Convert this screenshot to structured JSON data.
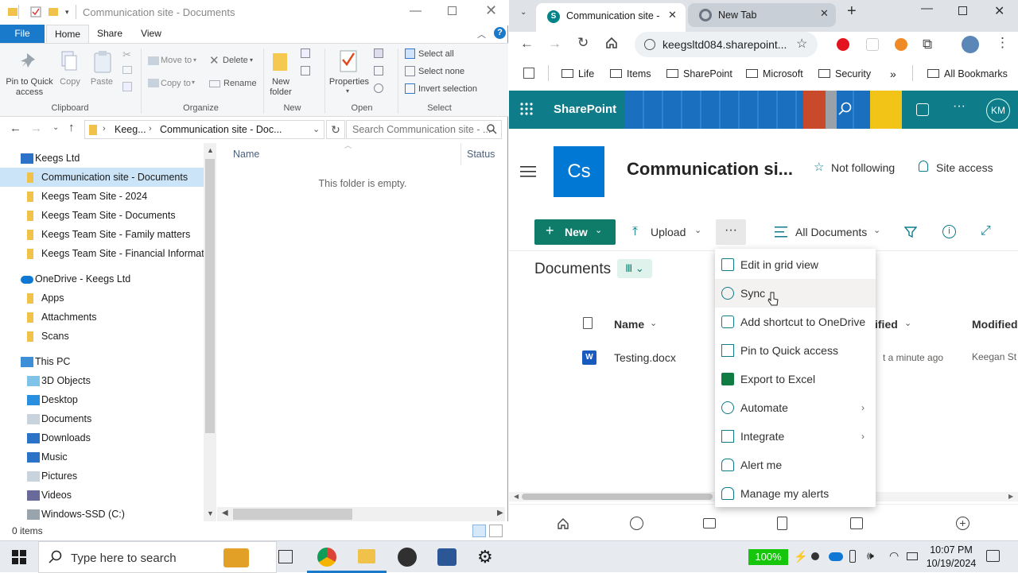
{
  "explorer": {
    "title": "Communication site - Documents",
    "tabs": [
      "File",
      "Home",
      "Share",
      "View"
    ],
    "ribbon": {
      "clipboard": {
        "pin": "Pin to Quick access",
        "copy": "Copy",
        "paste": "Paste",
        "group": "Clipboard"
      },
      "organize": {
        "move_to": "Move to",
        "copy_to": "Copy to",
        "delete": "Delete",
        "rename": "Rename",
        "group": "Organize"
      },
      "new": {
        "new_folder": "New folder",
        "group": "New"
      },
      "open": {
        "properties": "Properties",
        "group": "Open"
      },
      "select": {
        "select_all": "Select all",
        "select_none": "Select none",
        "invert": "Invert selection",
        "group": "Select"
      }
    },
    "address": {
      "crumb1": "Keeg...",
      "crumb2": "Communication site - Doc...",
      "search_placeholder": "Search Communication site - ..."
    },
    "nav": [
      {
        "label": "Keegs Ltd"
      },
      {
        "label": "Communication site - Documents"
      },
      {
        "label": "Keegs Team Site - 2024"
      },
      {
        "label": "Keegs Team Site - Documents"
      },
      {
        "label": "Keegs Team Site - Family matters"
      },
      {
        "label": "Keegs Team Site - Financial Information"
      },
      {
        "label": "OneDrive - Keegs Ltd"
      },
      {
        "label": "Apps"
      },
      {
        "label": "Attachments"
      },
      {
        "label": "Scans"
      },
      {
        "label": "This PC"
      },
      {
        "label": "3D Objects"
      },
      {
        "label": "Desktop"
      },
      {
        "label": "Documents"
      },
      {
        "label": "Downloads"
      },
      {
        "label": "Music"
      },
      {
        "label": "Pictures"
      },
      {
        "label": "Videos"
      },
      {
        "label": "Windows-SSD (C:)"
      }
    ],
    "columns": {
      "name": "Name",
      "status": "Status"
    },
    "empty_text": "This folder is empty.",
    "status_text": "0 items"
  },
  "chrome": {
    "tabs": [
      {
        "label": "Communication site - "
      },
      {
        "label": "New Tab"
      }
    ],
    "url": "keegsltd084.sharepoint...",
    "bookmarks": [
      "Life",
      "Items",
      "SharePoint",
      "Microsoft",
      "Security"
    ],
    "all_bookmarks": "All Bookmarks",
    "sharepoint": {
      "brand": "SharePoint",
      "avatar": "KM",
      "site_logo": "Cs",
      "site_title": "Communication si...",
      "follow": "Not following",
      "site_access": "Site access",
      "cmd": {
        "new": "New",
        "upload": "Upload",
        "view": "All Documents"
      },
      "library_title": "Documents",
      "columns": {
        "name": "Name",
        "modified_partial": "ified",
        "modified_by": "Modified"
      },
      "files": [
        {
          "name": "Testing.docx",
          "modified": "t a minute ago",
          "modified_by": "Keegan St"
        }
      ],
      "menu": [
        {
          "label": "Edit in grid view"
        },
        {
          "label": "Sync"
        },
        {
          "label": "Add shortcut to OneDrive"
        },
        {
          "label": "Pin to Quick access"
        },
        {
          "label": "Export to Excel"
        },
        {
          "label": "Automate"
        },
        {
          "label": "Integrate"
        },
        {
          "label": "Alert me"
        },
        {
          "label": "Manage my alerts"
        }
      ]
    }
  },
  "taskbar": {
    "search_placeholder": "Type here to search",
    "battery": "100%",
    "time": "10:07 PM",
    "date": "10/19/2024"
  },
  "colors": {
    "sp_teal": "#0f7c8a",
    "sp_green": "#107c6a",
    "explorer_blue": "#1979ca",
    "selected_nav": "#cce4f7"
  }
}
